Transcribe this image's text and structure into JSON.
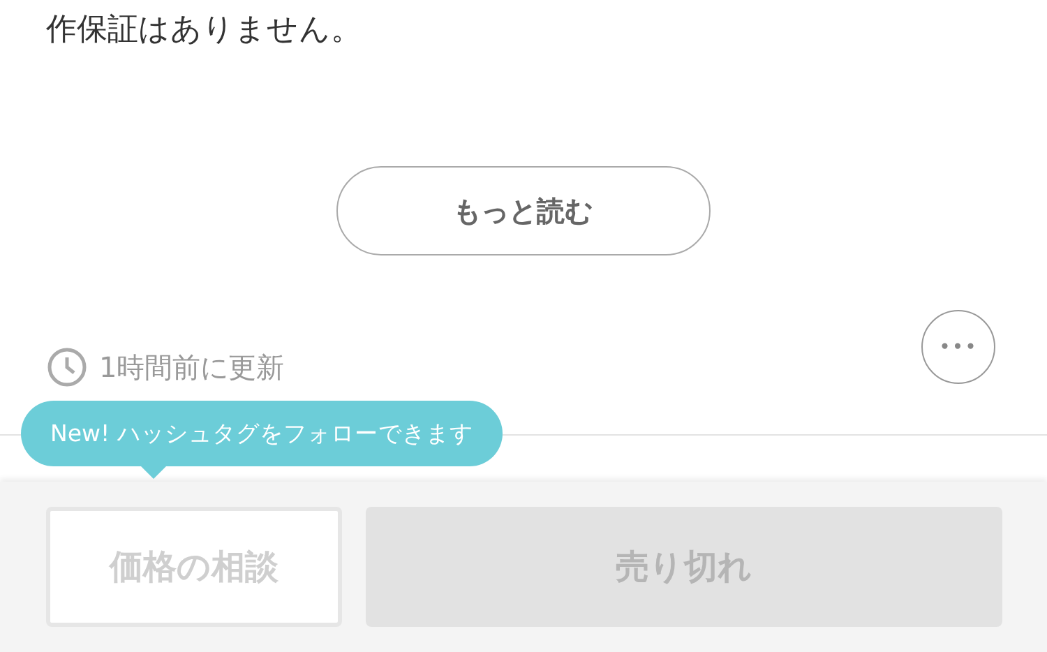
{
  "description": {
    "text": "作保証はありません。"
  },
  "read_more": {
    "label": "もっと読む"
  },
  "updated": {
    "text": "1時間前に更新"
  },
  "more_button": {
    "label": "•••"
  },
  "tooltip": {
    "text": "New! ハッシュタグをフォローできます"
  },
  "actions": [
    {
      "label": "価格の相談",
      "kind": "outline",
      "disabled": true
    },
    {
      "label": "売り切れ",
      "kind": "filled",
      "disabled": true
    }
  ]
}
